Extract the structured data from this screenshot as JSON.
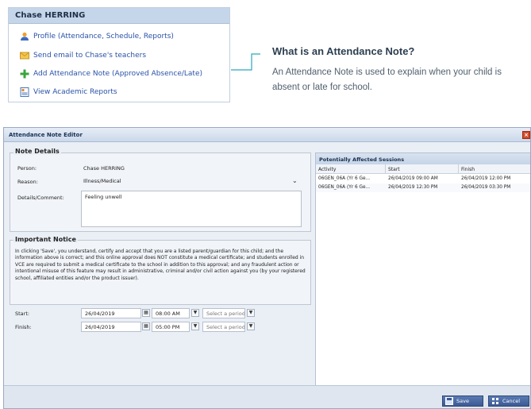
{
  "student_panel": {
    "header": "Chase HERRING",
    "links": [
      {
        "label": "Profile (Attendance, Schedule, Reports)",
        "icon": "user-icon"
      },
      {
        "label": "Send email to Chase's teachers",
        "icon": "envelope-icon"
      },
      {
        "label": "Add Attendance Note (Approved Absence/Late)",
        "icon": "plus-icon"
      },
      {
        "label": "View Academic Reports",
        "icon": "report-icon"
      }
    ]
  },
  "callout": {
    "title": "What is an Attendance Note?",
    "body": "An Attendance Note is used to explain when your child is absent or late for school."
  },
  "dialog": {
    "title": "Attendance Note Editor",
    "note_details": {
      "legend": "Note Details",
      "person_label": "Person:",
      "person_value": "Chase HERRING",
      "reason_label": "Reason:",
      "reason_value": "Illness/Medical",
      "details_label": "Details/Comment:",
      "details_value": "Feeling unwell"
    },
    "notice": {
      "legend": "Important Notice",
      "text": "In clicking 'Save', you understand, certify and accept that you are a listed parent/guardian for this child; and the information above is correct; and this online approval does NOT constitute a medical certificate; and students enrolled in VCE are required to submit a medical certificate to the school in addition to this approval; and any fraudulent action or intentional misuse of this feature may result in administrative, criminal and/or civil action against you (by your registered school, affiliated entities and/or the product issuer)."
    },
    "start": {
      "label": "Start:",
      "date": "26/04/2019",
      "time": "08:00 AM",
      "period_placeholder": "Select a period..."
    },
    "finish": {
      "label": "Finish:",
      "date": "26/04/2019",
      "time": "05:00 PM",
      "period_placeholder": "Select a period..."
    },
    "sessions": {
      "header": "Potentially Affected Sessions",
      "columns": [
        "Activity",
        "Start",
        "Finish"
      ],
      "rows": [
        [
          "06GEN_06A (Yr 6 Ge...",
          "26/04/2019 09:00 AM",
          "26/04/2019 12:00 PM"
        ],
        [
          "06GEN_06A (Yr 6 Ge...",
          "26/04/2019 12:30 PM",
          "26/04/2019 03:30 PM"
        ]
      ]
    },
    "buttons": {
      "save": "Save",
      "cancel": "Cancel"
    }
  },
  "colors": {
    "accent": "#2a52a8",
    "connector": "#2aa6bf",
    "dialog_bg": "#eaeff6"
  }
}
